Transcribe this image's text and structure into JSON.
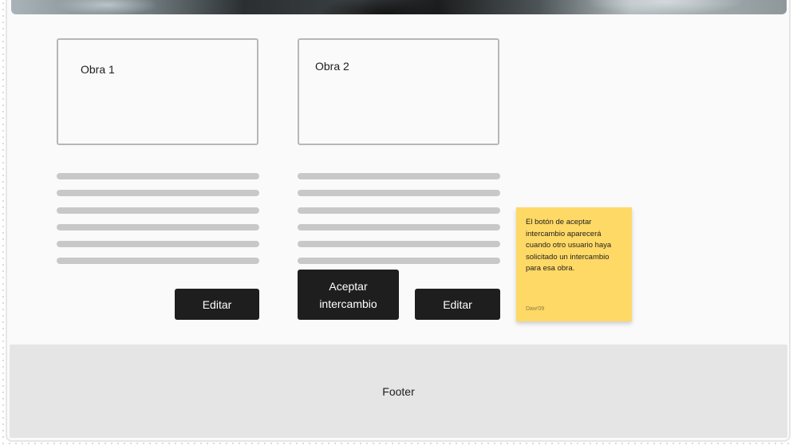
{
  "obras": [
    {
      "title": "Obra 1",
      "buttons": {
        "edit_label": "Editar"
      }
    },
    {
      "title": "Obra 2",
      "buttons": {
        "accept_label": "Aceptar\nintercambio",
        "edit_label": "Editar"
      }
    }
  ],
  "sticky_note": {
    "text": "El botón de aceptar intercambio aparecerá cuando otro usuario haya solicitado un intercambio para esa obra.",
    "author": "Daw'09"
  },
  "footer": {
    "label": "Footer"
  },
  "colors": {
    "button_bg": "#1e1e1e",
    "sticky_bg": "#ffd966",
    "footer_bg": "#e5e5e5",
    "placeholder_line": "#c8c8c8"
  }
}
